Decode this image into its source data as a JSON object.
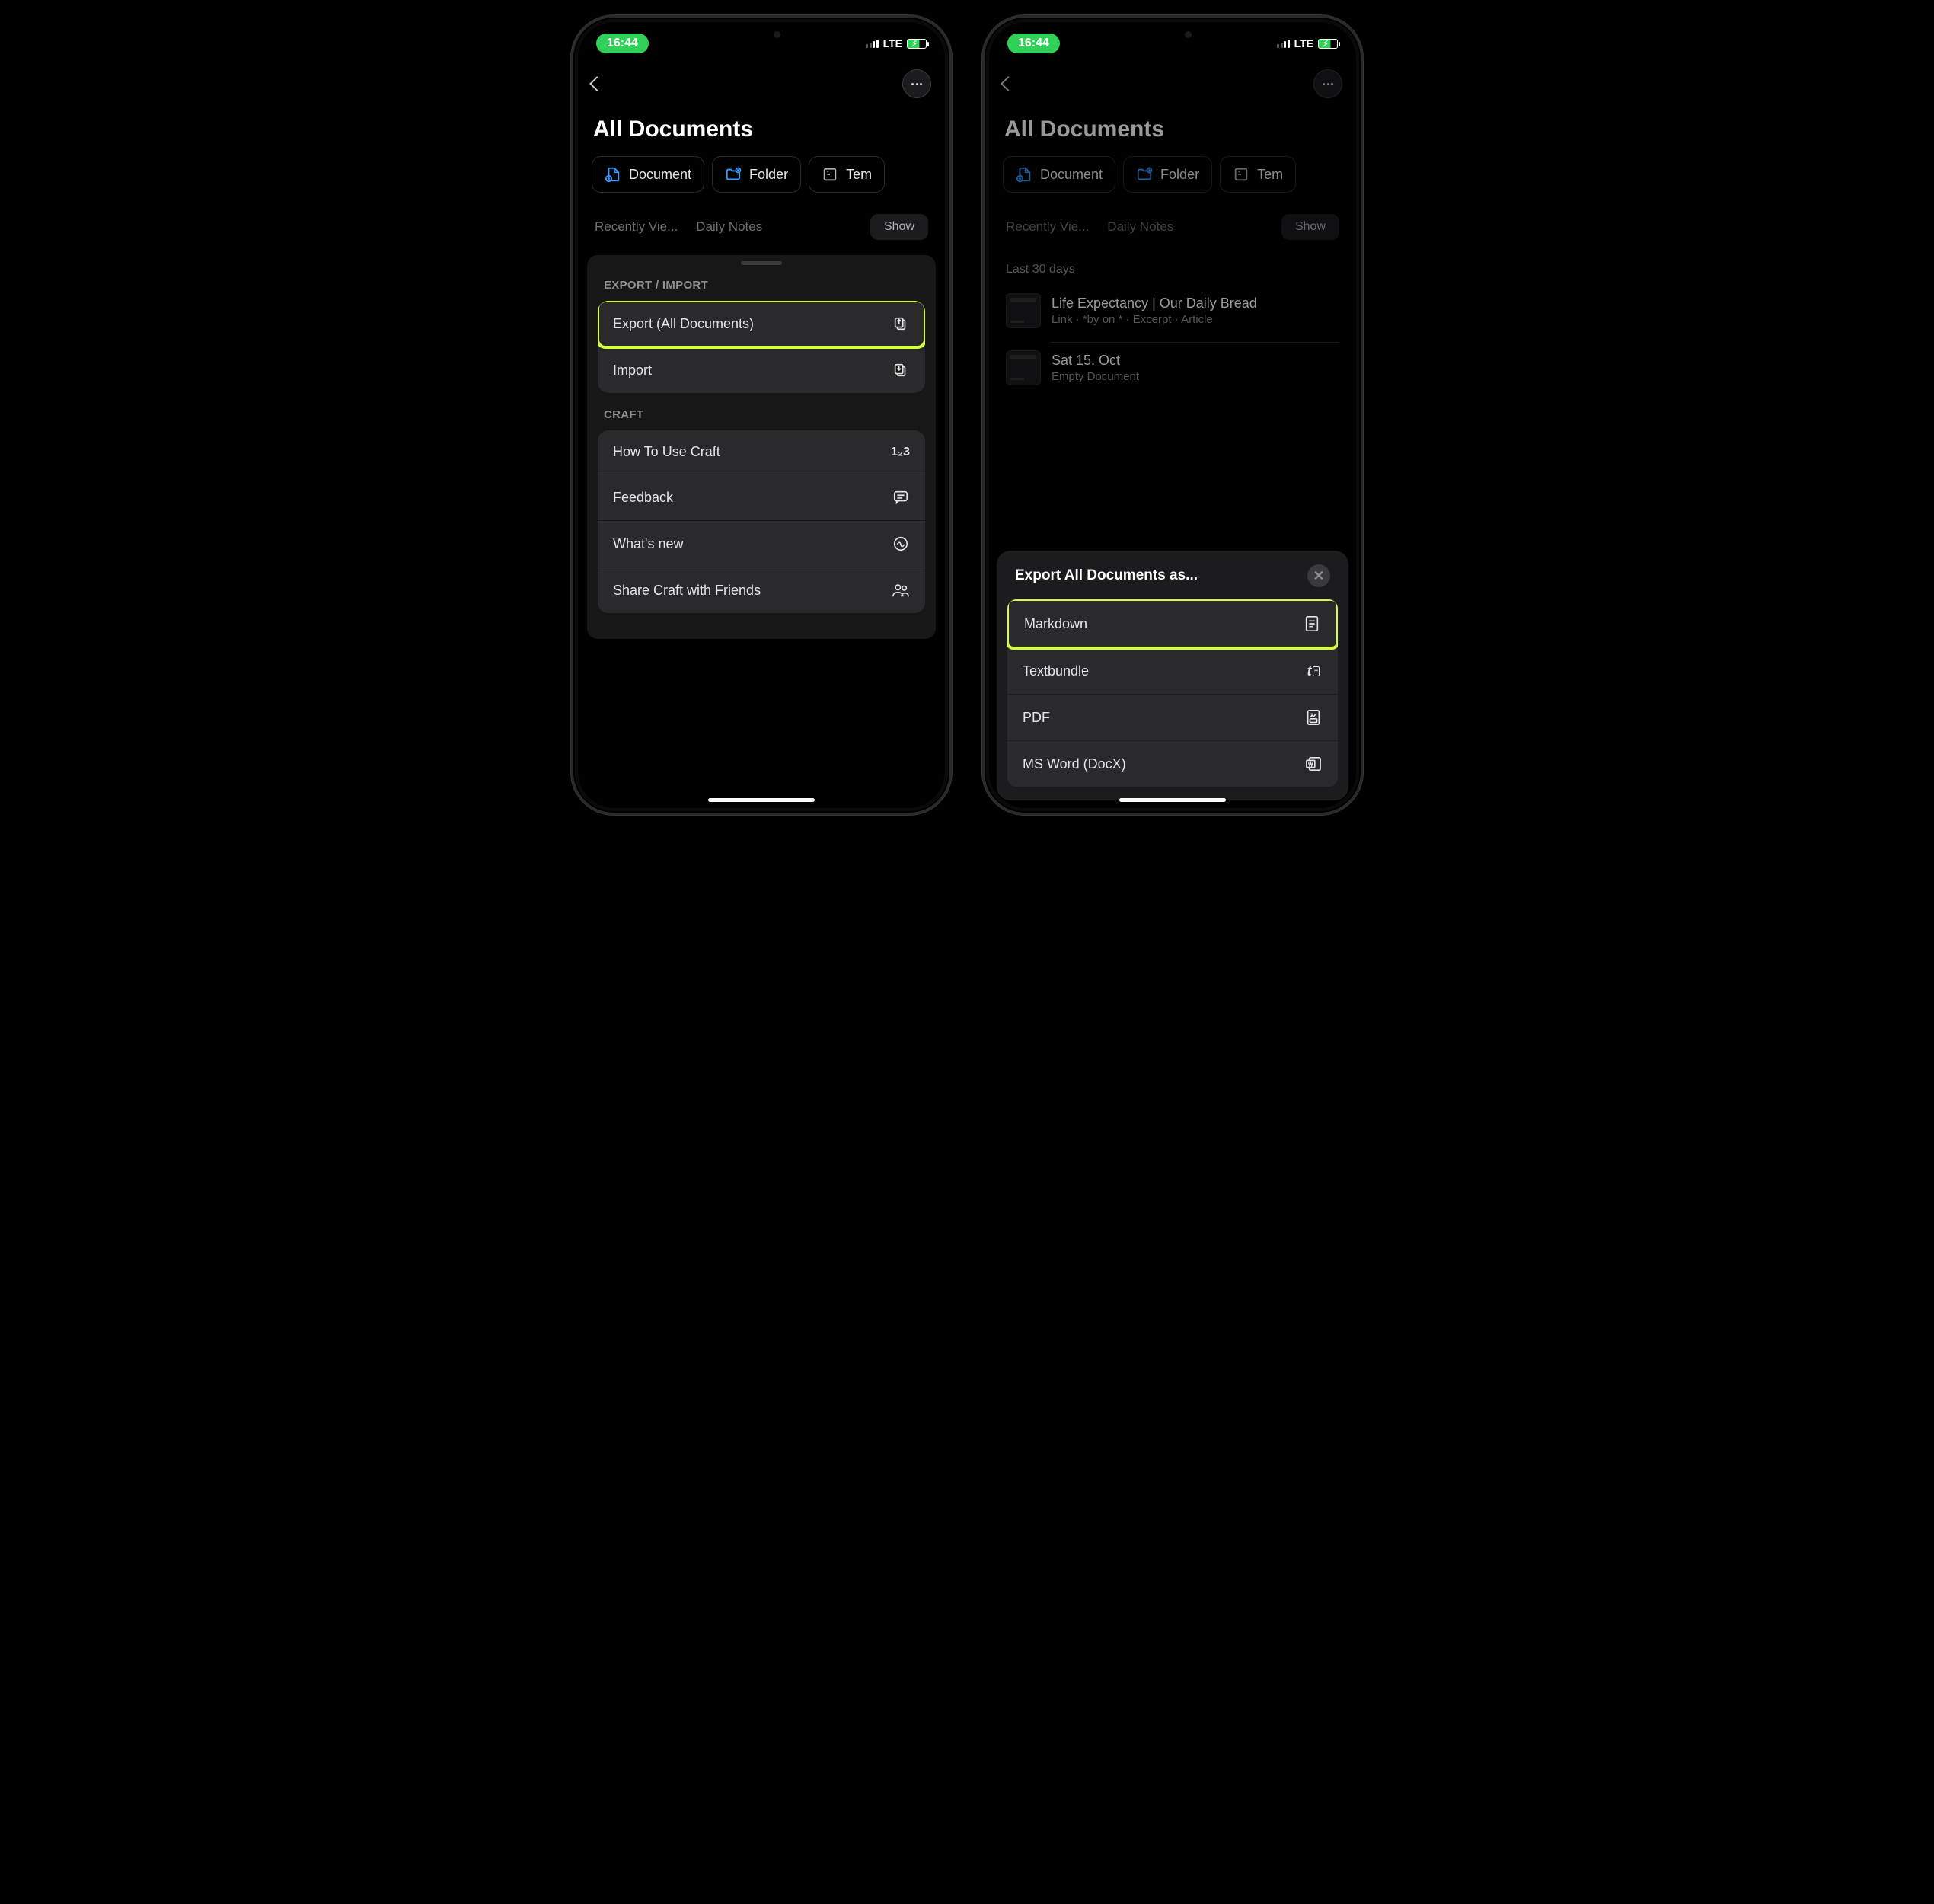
{
  "status": {
    "time": "16:44",
    "net": "LTE"
  },
  "page_title": "All Documents",
  "chips": {
    "document": "Document",
    "folder": "Folder",
    "template": "Tem"
  },
  "tabs": {
    "recent": "Recently Vie...",
    "daily": "Daily Notes",
    "show": "Show"
  },
  "sheet1": {
    "sect_export": "EXPORT / IMPORT",
    "export_all": "Export (All Documents)",
    "import": "Import",
    "sect_craft": "CRAFT",
    "howto": "How To Use Craft",
    "howto_badge": "1₂3",
    "feedback": "Feedback",
    "whatsnew": "What's new",
    "share": "Share Craft with Friends"
  },
  "phone2": {
    "section": "Last 30 days",
    "doc1_title": "Life Expectancy | Our Daily Bread",
    "doc1_sub": "Link · *by  on * · Excerpt · Article",
    "doc2_title": "Sat 15. Oct",
    "doc2_sub": "Empty Document",
    "export_title": "Export All Documents as...",
    "opt_md": "Markdown",
    "opt_tb": "Textbundle",
    "opt_pdf": "PDF",
    "opt_docx": "MS Word (DocX)"
  }
}
